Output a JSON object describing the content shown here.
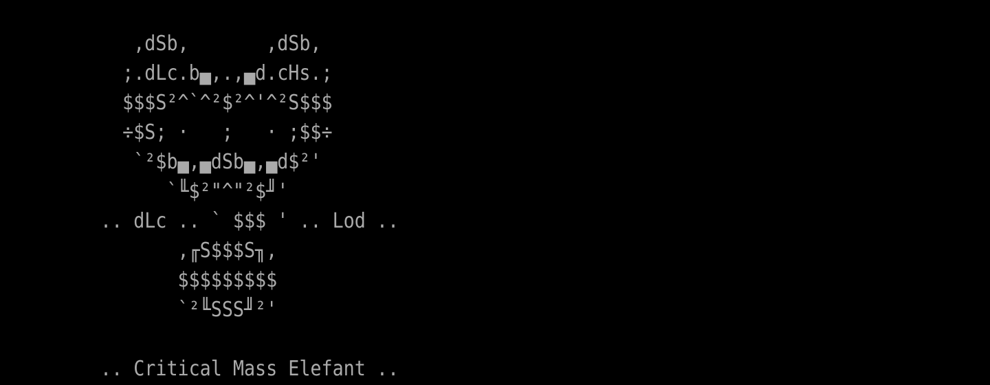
{
  "terminal": {
    "background": "#000000",
    "foreground": "#aaaaaa",
    "lines": [
      "   ,dSb,       ,dSb,",
      "  ;.dLc.b▄,.,▄d.cHs.;",
      "  $$$S²^`^²$²^'^²S$$$",
      "  ÷$S; ·   ;   · ;$$÷",
      "   `²$b▄,▄dSb▄,▄d$²'",
      "      `╙$²\"^\"²$╜'",
      ".. dLc .. ` $$$ ' .. Lod ..",
      "       ,╓S$$$S╖,",
      "       $$$$$$$$$",
      "       `²╙SSS╜²'",
      "",
      ".. Critical Mass Elefant .."
    ]
  }
}
